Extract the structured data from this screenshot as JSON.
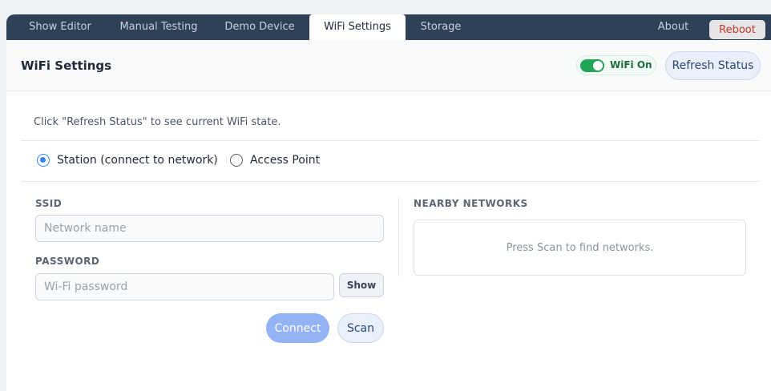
{
  "tabs": [
    {
      "label": "Show Editor"
    },
    {
      "label": "Manual Testing"
    },
    {
      "label": "Demo Device"
    },
    {
      "label": "WiFi Settings",
      "active": true
    },
    {
      "label": "Storage"
    },
    {
      "label": "About"
    }
  ],
  "reboot_label": "Reboot",
  "header": {
    "title": "WiFi Settings",
    "wifi_toggle": {
      "label": "WiFi On",
      "on": true
    },
    "refresh_label": "Refresh Status"
  },
  "status_message": "Click \"Refresh Status\" to see current WiFi state.",
  "mode": {
    "options": [
      {
        "label": "Station (connect to network)",
        "selected": true
      },
      {
        "label": "Access Point",
        "selected": false
      }
    ]
  },
  "form": {
    "ssid": {
      "label": "SSID",
      "value": "",
      "placeholder": "Network name"
    },
    "password": {
      "label": "PASSWORD",
      "value": "",
      "placeholder": "Wi-Fi password"
    },
    "show_label": "Show",
    "connect_label": "Connect",
    "scan_label": "Scan"
  },
  "networks": {
    "heading": "NEARBY NETWORKS",
    "empty_text": "Press Scan to find networks."
  },
  "colors": {
    "tabbar": "#2f4156",
    "accent": "#3b82f6",
    "wifi_on": "#22a559",
    "reboot_text": "#c0392b"
  }
}
